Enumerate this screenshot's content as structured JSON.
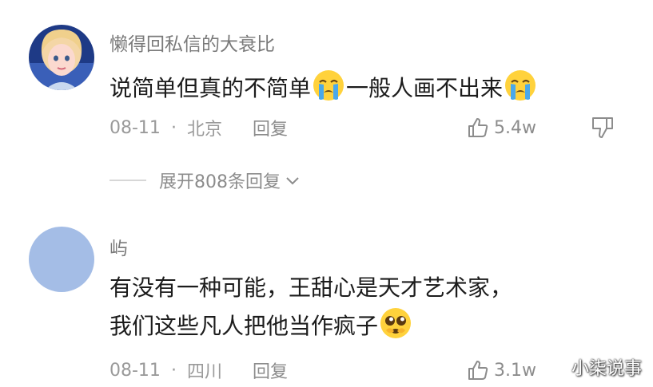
{
  "comments": [
    {
      "username": "懒得回私信的大衰比",
      "text_parts": [
        "说简单但真的不简单",
        "一般人画不出来"
      ],
      "emojis": [
        "crying-face-emoji",
        "crying-face-emoji"
      ],
      "date": "08-11",
      "separator": "·",
      "location": "北京",
      "reply_label": "回复",
      "likes": "5.4w",
      "expand_replies_label": "展开808条回复",
      "avatar": "cartoon-girl-avatar"
    },
    {
      "username": "屿",
      "text_lines": [
        "有没有一种可能，王甜心是天才艺术家，",
        "我们这些凡人把他当作疯子"
      ],
      "emojis": [
        "pleading-face-emoji"
      ],
      "date": "08-11",
      "separator": "·",
      "location": "四川",
      "reply_label": "回复",
      "likes": "3.1w",
      "avatar": "plain-blue-avatar"
    }
  ],
  "icons": {
    "like": "thumbs-up-icon",
    "dislike": "thumbs-down-icon",
    "expand": "chevron-down-icon"
  },
  "watermark": "小柒说事",
  "colors": {
    "text_primary": "#1c1c1c",
    "text_secondary": "#9a9a9a",
    "avatar_blue": "#a4bde6",
    "emoji_yellow": "#ffd23c"
  }
}
